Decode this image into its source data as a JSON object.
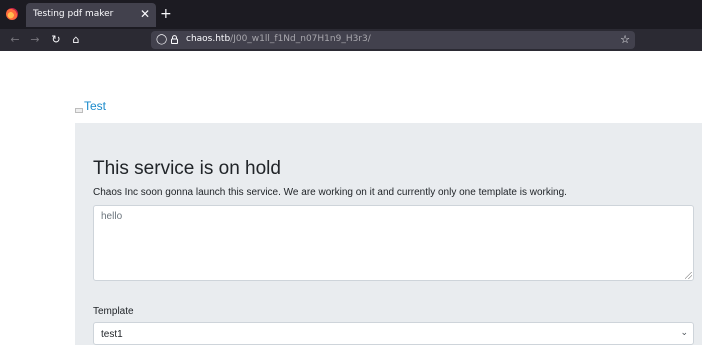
{
  "browser": {
    "tab_title": "Testing pdf maker",
    "tab_close_glyph": "✕",
    "new_tab_glyph": "+",
    "url_host": "chaos.htb",
    "url_path": "/J00_w1ll_f1Nd_n07H1n9_H3r3/",
    "icons": {
      "browser": "firefox-icon",
      "back": "arrow-left-icon",
      "forward": "arrow-right-icon",
      "reload": "reload-icon",
      "home": "home-icon",
      "shield": "shield-icon",
      "lock": "lock-icon",
      "bookmark": "star-icon"
    }
  },
  "navbar": {
    "brand_label": "Test"
  },
  "main": {
    "heading": "This service is on hold",
    "lead": "Chaos Inc soon gonna launch this service. We are working on it and currently only one template is working.",
    "textarea_value": "hello",
    "template_label": "Template",
    "template_selected": "test1"
  },
  "colors": {
    "link": "#1a8acb",
    "jumbotron_bg": "#e9ecef",
    "chrome_dark": "#1c1b22",
    "chrome_toolbar": "#2b2a33",
    "urlbar_bg": "#42414d"
  }
}
